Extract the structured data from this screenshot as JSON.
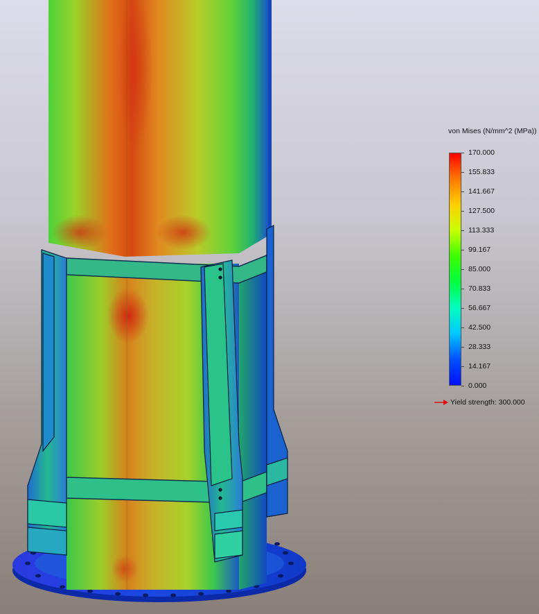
{
  "legend": {
    "title": "von Mises (N/mm^2 (MPa))",
    "ticks": [
      "170.000",
      "155.833",
      "141.667",
      "127.500",
      "113.333",
      "99.167",
      "85.000",
      "70.833",
      "56.667",
      "42.500",
      "28.333",
      "14.167",
      "0.000"
    ],
    "colors": [
      "#ff0000",
      "#ff7a00",
      "#ffd000",
      "#c8ff00",
      "#3cff00",
      "#00ff40",
      "#00ffc0",
      "#00c8ff",
      "#0050ff",
      "#0010ff"
    ],
    "yield_label": "Yield strength: 300.000",
    "yield_arrow_color": "#e01010"
  },
  "model": {
    "icons": [
      "flange-plate",
      "gusset-plates",
      "tower-shell"
    ]
  }
}
